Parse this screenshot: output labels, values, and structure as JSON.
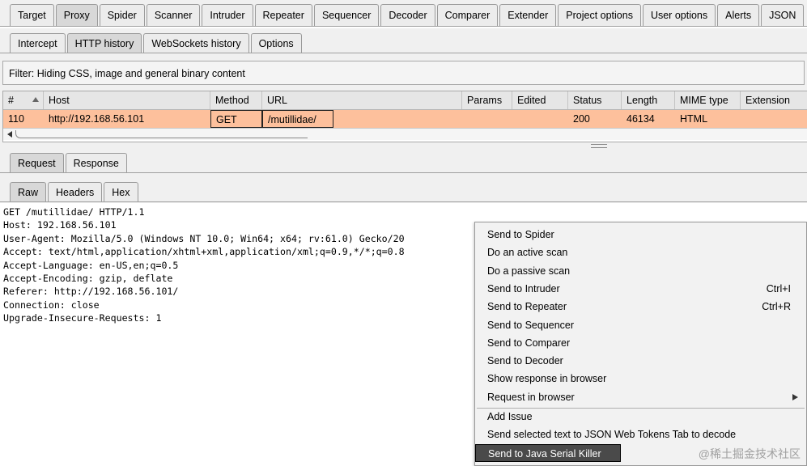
{
  "top_tabs": [
    "Target",
    "Proxy",
    "Spider",
    "Scanner",
    "Intruder",
    "Repeater",
    "Sequencer",
    "Decoder",
    "Comparer",
    "Extender",
    "Project options",
    "User options",
    "Alerts",
    "JSON"
  ],
  "top_tabs_selected": "Proxy",
  "proxy_tabs": [
    "Intercept",
    "HTTP history",
    "WebSockets history",
    "Options"
  ],
  "proxy_tabs_selected": "HTTP history",
  "filter_text": "Filter: Hiding CSS, image and general binary content",
  "table": {
    "columns": [
      "#",
      "Host",
      "Method",
      "URL",
      "Params",
      "Edited",
      "Status",
      "Length",
      "MIME type",
      "Extension"
    ],
    "rows": [
      {
        "num": "110",
        "host": "http://192.168.56.101",
        "method": "GET",
        "url": "/mutillidae/",
        "params": "",
        "edited": "",
        "status": "200",
        "length": "46134",
        "mime": "HTML",
        "extension": ""
      }
    ]
  },
  "message_tabs": [
    "Request",
    "Response"
  ],
  "message_tabs_selected": "Request",
  "view_tabs": [
    "Raw",
    "Headers",
    "Hex"
  ],
  "view_tabs_selected": "Raw",
  "request_lines": [
    "GET /mutillidae/ HTTP/1.1",
    "Host: 192.168.56.101",
    "User-Agent: Mozilla/5.0 (Windows NT 10.0; Win64; x64; rv:61.0) Gecko/20",
    "Accept: text/html,application/xhtml+xml,application/xml;q=0.9,*/*;q=0.8",
    "Accept-Language: en-US,en;q=0.5",
    "Accept-Encoding: gzip, deflate",
    "Referer: http://192.168.56.101/",
    "Connection: close",
    "Upgrade-Insecure-Requests: 1"
  ],
  "context_menu": {
    "items": [
      {
        "label": "Send to Spider",
        "shortcut": ""
      },
      {
        "label": "Do an active scan",
        "shortcut": ""
      },
      {
        "label": "Do a passive scan",
        "shortcut": ""
      },
      {
        "label": "Send to Intruder",
        "shortcut": "Ctrl+I"
      },
      {
        "label": "Send to Repeater",
        "shortcut": "Ctrl+R"
      },
      {
        "label": "Send to Sequencer",
        "shortcut": ""
      },
      {
        "label": "Send to Comparer",
        "shortcut": ""
      },
      {
        "label": "Send to Decoder",
        "shortcut": ""
      },
      {
        "label": "Show response in browser",
        "shortcut": ""
      },
      {
        "label": "Request in browser",
        "shortcut": ""
      },
      {
        "label": "Add Issue",
        "shortcut": ""
      },
      {
        "label": "Send selected text to JSON Web Tokens Tab to decode",
        "shortcut": ""
      },
      {
        "label": "Send to Java Serial Killer",
        "shortcut": ""
      }
    ],
    "submenu_item": "Request in browser",
    "highlighted": "Send to Java Serial Killer"
  },
  "watermark": "@稀土掘金技术社区",
  "colors": {
    "selected_row": "#fdc09c",
    "menu_highlight": "#4a4a4a"
  }
}
